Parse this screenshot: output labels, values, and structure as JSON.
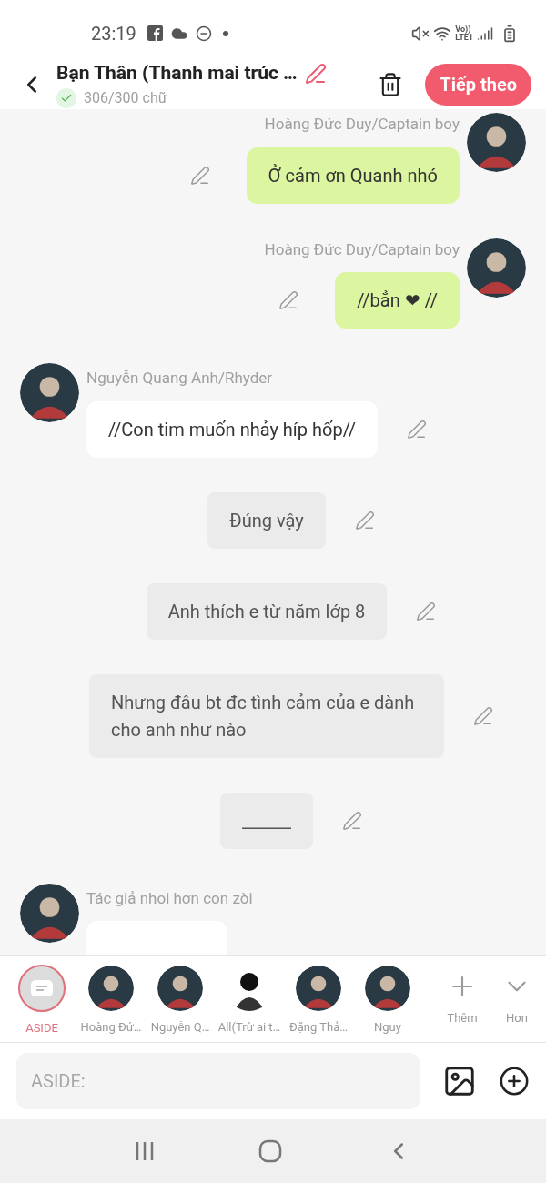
{
  "status_bar": {
    "time": "23:19",
    "network_top": "Vo))",
    "network_bottom": "LTE1"
  },
  "header": {
    "title": "Bạn Thân (Thanh mai trúc …",
    "count": "306/300 chữ",
    "count_ok": true,
    "next_button": "Tiếp theo"
  },
  "messages": [
    {
      "kind": "right",
      "author": "Hoàng Đức Duy/Captain boy",
      "text": "Ở cảm ơn Quanh nhó"
    },
    {
      "kind": "right",
      "author": "Hoàng Đức Duy/Captain boy",
      "text": "//bẳn ❤ //"
    },
    {
      "kind": "left",
      "author": "Nguyễn Quang Anh/Rhyder",
      "text": "//Con tim muốn nhảy híp hốp//"
    },
    {
      "kind": "aside",
      "text": "Đúng vậy"
    },
    {
      "kind": "aside",
      "text": "Anh thích e từ năm lớp 8"
    },
    {
      "kind": "aside",
      "text": "Nhưng đâu bt đc tình cảm của e dành cho anh như nào"
    },
    {
      "kind": "aside",
      "text": "______"
    },
    {
      "kind": "left",
      "author": "Tác giả nhoi hơn con zòi"
    }
  ],
  "characters": [
    {
      "kind": "aside",
      "label": "ASIDE",
      "selected": true
    },
    {
      "kind": "character",
      "label": "Hoàng Đứ…",
      "selected": false
    },
    {
      "kind": "character",
      "label": "Nguyễn Q…",
      "selected": false
    },
    {
      "kind": "silhouette",
      "label": "All(Trừ ai t…",
      "selected": false
    },
    {
      "kind": "character",
      "label": "Đặng Thả…",
      "selected": false
    },
    {
      "kind": "character",
      "label": "Nguy",
      "selected": false
    }
  ],
  "character_actions": [
    {
      "kind": "add",
      "label": "Thêm"
    },
    {
      "kind": "more",
      "label": "Hơn"
    }
  ],
  "composer": {
    "placeholder": "ASIDE:"
  }
}
